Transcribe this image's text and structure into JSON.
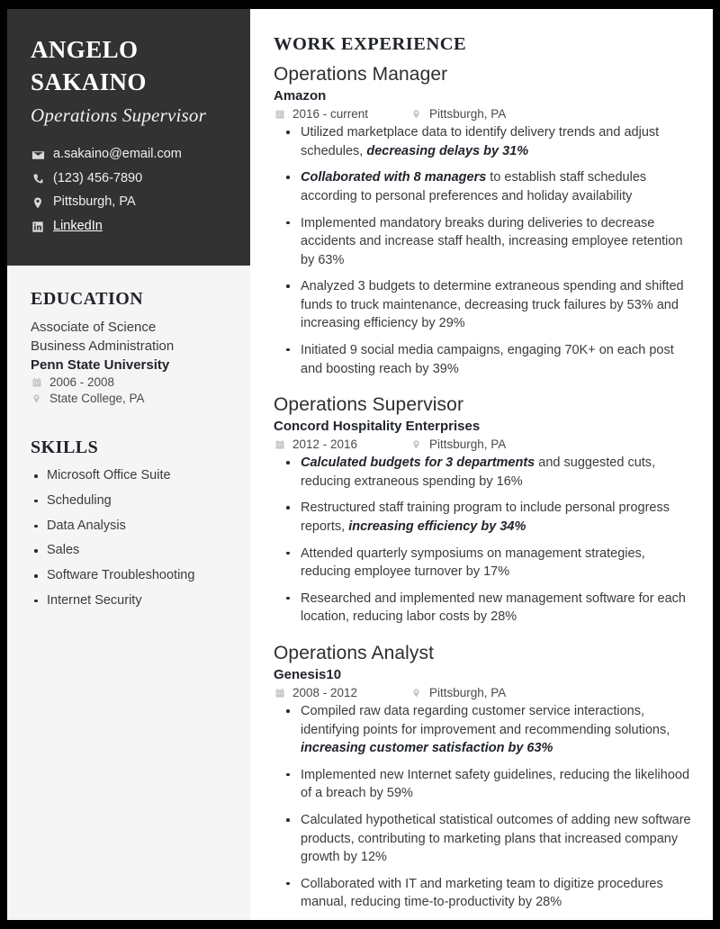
{
  "sidebar": {
    "name_first": "ANGELO",
    "name_last": "SAKAINO",
    "headline": "Operations Supervisor",
    "contacts": [
      {
        "icon": "envelope-icon",
        "value": "a.sakaino@email.com",
        "link": false
      },
      {
        "icon": "phone-icon",
        "value": "(123) 456-7890",
        "link": false
      },
      {
        "icon": "location-pin-icon",
        "value": "Pittsburgh, PA",
        "link": false
      },
      {
        "icon": "linkedin-icon",
        "value": "LinkedIn",
        "link": true
      }
    ],
    "education": {
      "heading": "EDUCATION",
      "degree_line1": "Associate of Science",
      "degree_line2": "Business Administration",
      "school": "Penn State University",
      "dates": "2006 - 2008",
      "location": "State College, PA"
    },
    "skills": {
      "heading": "SKILLS",
      "items": [
        "Microsoft Office Suite",
        "Scheduling",
        "Data Analysis",
        "Sales",
        "Software Troubleshooting",
        "Internet Security"
      ]
    }
  },
  "main": {
    "heading": "WORK EXPERIENCE",
    "jobs": [
      {
        "title": "Operations Manager",
        "company": "Amazon",
        "dates": "2016 - current",
        "location": "Pittsburgh, PA",
        "bullets": [
          {
            "pre": "Utilized marketplace data to identify delivery trends and adjust schedules, ",
            "em": "decreasing delays by 31%",
            "post": ""
          },
          {
            "pre": "",
            "em": "Collaborated with 8 managers",
            "post": " to establish staff schedules according to personal preferences and holiday availability"
          },
          {
            "pre": "Implemented mandatory breaks during deliveries to decrease accidents and increase staff health, increasing employee retention by 63%",
            "em": "",
            "post": ""
          },
          {
            "pre": "Analyzed 3 budgets to determine extraneous spending and shifted funds to truck maintenance, decreasing truck failures by 53% and increasing efficiency by 29%",
            "em": "",
            "post": ""
          },
          {
            "pre": "Initiated 9 social media campaigns, engaging 70K+ on each post and boosting reach by 39%",
            "em": "",
            "post": ""
          }
        ]
      },
      {
        "title": "Operations Supervisor",
        "company": "Concord Hospitality Enterprises",
        "dates": "2012 - 2016",
        "location": "Pittsburgh, PA",
        "bullets": [
          {
            "pre": "",
            "em": "Calculated budgets for 3 departments",
            "post": " and suggested cuts, reducing extraneous spending by 16%"
          },
          {
            "pre": "Restructured staff training program to include personal progress reports, ",
            "em": "increasing efficiency by 34%",
            "post": ""
          },
          {
            "pre": "Attended quarterly symposiums on management strategies, reducing employee turnover by 17%",
            "em": "",
            "post": ""
          },
          {
            "pre": "Researched and implemented new management software for each location, reducing labor costs by 28%",
            "em": "",
            "post": ""
          }
        ]
      },
      {
        "title": "Operations Analyst",
        "company": "Genesis10",
        "dates": "2008 - 2012",
        "location": "Pittsburgh, PA",
        "bullets": [
          {
            "pre": "Compiled raw data regarding customer service interactions, identifying points for improvement and recommending solutions, ",
            "em": "increasing customer satisfaction by 63%",
            "post": ""
          },
          {
            "pre": "Implemented new Internet safety guidelines, reducing the likelihood of a breach by 59%",
            "em": "",
            "post": ""
          },
          {
            "pre": "Calculated hypothetical statistical outcomes of adding new software products, contributing to marketing plans that increased company growth by 12%",
            "em": "",
            "post": ""
          },
          {
            "pre": "Collaborated with IT and marketing team to digitize procedures manual, reducing time-to-productivity by 28%",
            "em": "",
            "post": ""
          }
        ]
      }
    ]
  }
}
